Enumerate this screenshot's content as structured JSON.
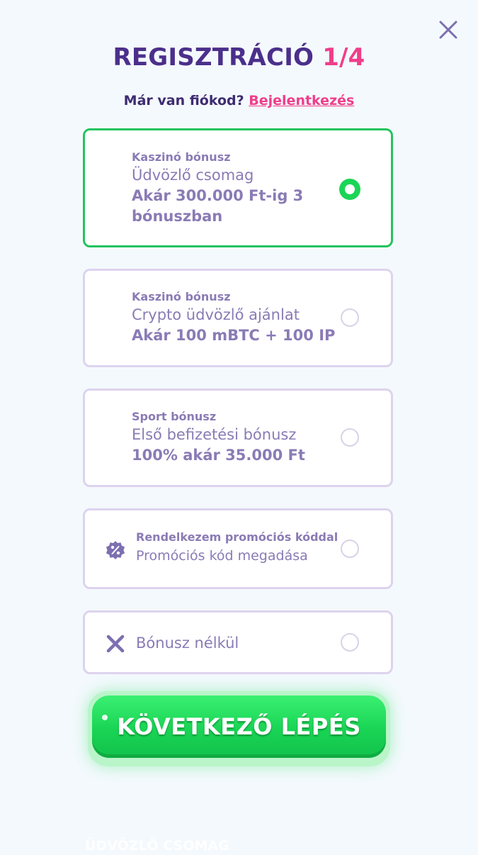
{
  "title": {
    "main": "REGISZTRÁCIÓ",
    "step": "1/4"
  },
  "login": {
    "prompt": "Már van fiókod?",
    "link": "Bejelentkezés"
  },
  "options": [
    {
      "eyebrow": "Kaszinó bónusz",
      "name": "Üdvözlő csomag",
      "offer": "Akár 300.000 Ft-ig 3 bónuszban",
      "selected": true
    },
    {
      "eyebrow": "Kaszinó bónusz",
      "name": "Crypto üdvözlő ajánlat",
      "offer": "Akár 100 mBTC + 100 IP",
      "selected": false
    },
    {
      "eyebrow": "Sport bónusz",
      "name": "Első befizetési bónusz",
      "offer": "100% akár 35.000 Ft",
      "selected": false
    }
  ],
  "promo": {
    "label": "Rendelkezem promóciós kóddal",
    "sublabel": "Promóciós kód megadása",
    "icon": "percent-badge-icon"
  },
  "no_bonus": {
    "label": "Bónusz nélkül",
    "icon": "close-x-icon"
  },
  "cta": {
    "label": "KÖVETKEZŐ LÉPÉS"
  },
  "footer_ghost": "ÜDVÖZLŐ CSOMAG",
  "colors": {
    "accent": "#ef3e8a",
    "title": "#4b2f8b",
    "selected_border": "#22c55e",
    "cta": "#1bd556",
    "text": "#8a7bb5"
  }
}
